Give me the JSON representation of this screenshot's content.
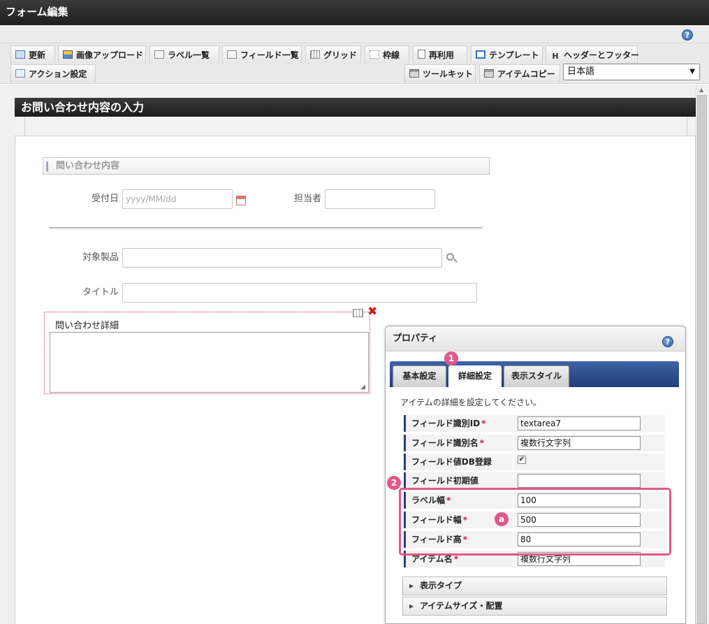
{
  "window": {
    "title": "フォーム編集"
  },
  "toolbar": {
    "row1": [
      {
        "name": "update",
        "label": "更新",
        "icon": "refresh-icon"
      },
      {
        "name": "image-upload",
        "label": "画像アップロード",
        "icon": "image-icon"
      },
      {
        "name": "label-list",
        "label": "ラベル一覧",
        "icon": "list-icon"
      },
      {
        "name": "field-list",
        "label": "フィールド一覧",
        "icon": "list-icon"
      },
      {
        "name": "grid",
        "label": "グリッド",
        "icon": "grid-icon"
      },
      {
        "name": "frame-line",
        "label": "枠線",
        "icon": "frame-icon"
      },
      {
        "name": "reuse",
        "label": "再利用",
        "icon": "document-icon"
      },
      {
        "name": "template",
        "label": "テンプレート",
        "icon": "template-icon"
      },
      {
        "name": "header-footer",
        "label": "ヘッダーとフッター",
        "icon": "h-icon"
      }
    ],
    "row2": {
      "action": {
        "label": "アクション設定",
        "icon": "action-icon"
      },
      "toolkit": {
        "label": "ツールキット",
        "icon": "toolbox-icon"
      },
      "item_copy": {
        "label": "アイテムコピー",
        "icon": "toolbox-icon"
      }
    },
    "language": {
      "value": "日本語"
    },
    "help_icon": "?"
  },
  "form": {
    "title": "お問い合わせ内容の入力",
    "section": "問い合わせ内容",
    "fields": {
      "received_date": {
        "label": "受付日",
        "placeholder": "yyyy/MM/dd"
      },
      "assignee": {
        "label": "担当者"
      },
      "product": {
        "label": "対象製品"
      },
      "title": {
        "label": "タイトル"
      },
      "detail": {
        "label": "問い合わせ詳細"
      }
    }
  },
  "property_panel": {
    "title": "プロパティ",
    "help_icon": "?",
    "tabs": [
      "基本設定",
      "詳細設定",
      "表示スタイル"
    ],
    "active_tab": "詳細設定",
    "description": "アイテムの詳細を設定してください。",
    "rows": [
      {
        "label": "フィールド識別ID",
        "required": true,
        "value": "textarea7"
      },
      {
        "label": "フィールド識別名",
        "required": true,
        "value": "複数行文字列"
      },
      {
        "label": "フィールド値DB登録",
        "required": false,
        "checked": true
      },
      {
        "label": "フィールド初期値",
        "required": false,
        "value": ""
      },
      {
        "label": "ラベル幅",
        "required": true,
        "value": "100"
      },
      {
        "label": "フィールド幅",
        "required": true,
        "value": "500"
      },
      {
        "label": "フィールド高",
        "required": true,
        "value": "80"
      },
      {
        "label": "アイテム名",
        "required": true,
        "value": "複数行文字列"
      }
    ],
    "required_mark": "*",
    "sections": [
      "表示タイプ",
      "アイテムサイズ・配置"
    ]
  },
  "annotations": {
    "badge_1": "1",
    "badge_2": "2",
    "badge_a": "a",
    "highlight_color": "#e1588a"
  }
}
